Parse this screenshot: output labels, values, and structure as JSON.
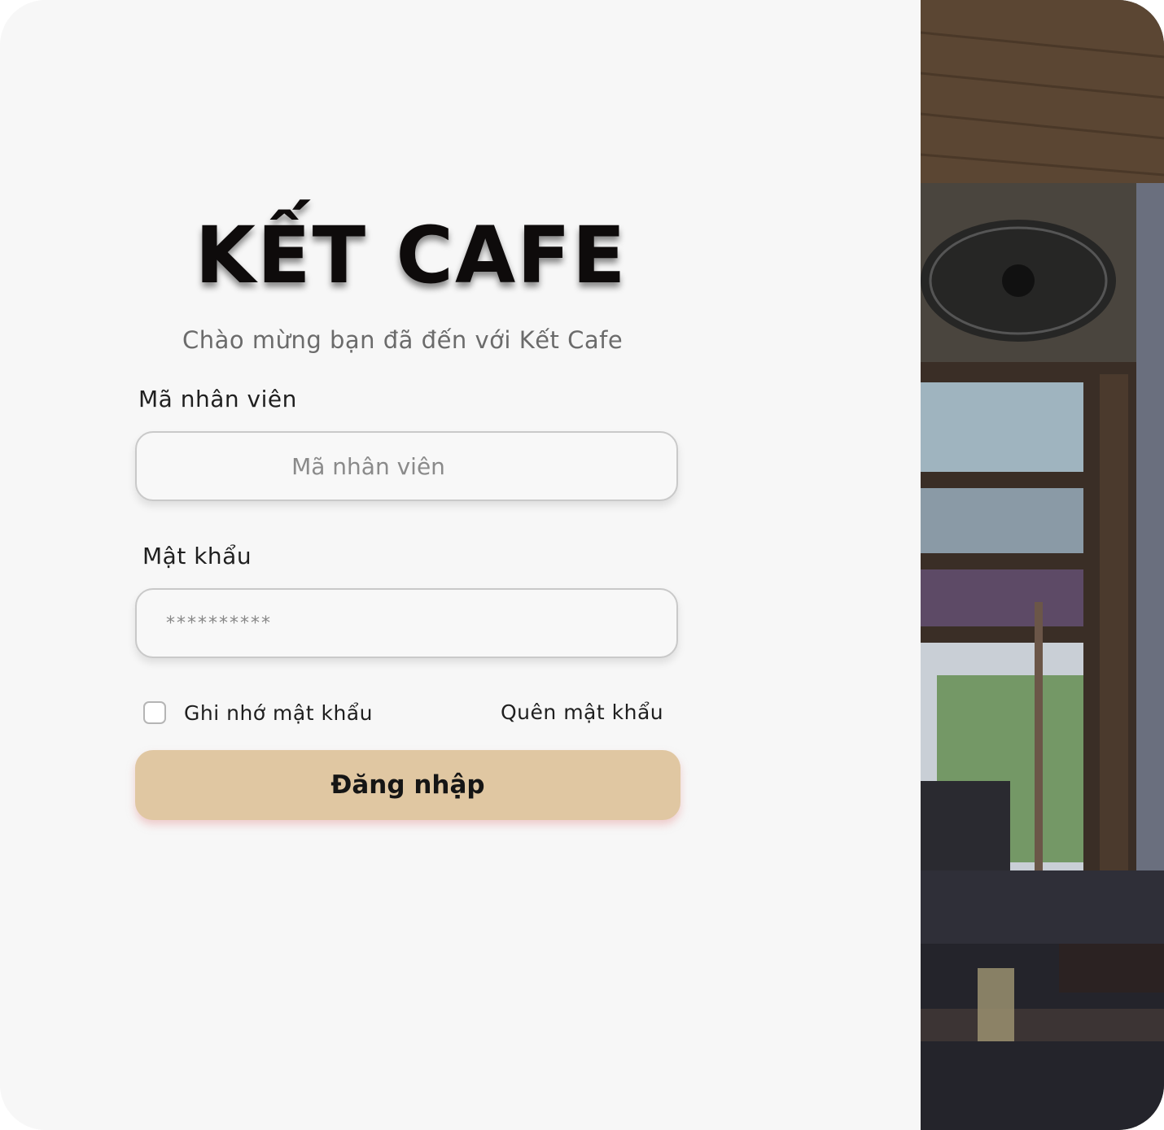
{
  "brand": {
    "title": "KẾT CAFE",
    "subtitle": "Chào mừng bạn đã đến với Kết Cafe"
  },
  "form": {
    "employee_id": {
      "label": "Mã nhân viên",
      "placeholder": "Mã nhân viên",
      "value": ""
    },
    "password": {
      "label": "Mật khẩu",
      "placeholder": "**********",
      "value": ""
    },
    "remember_label": "Ghi nhớ mật khẩu",
    "remember_checked": false,
    "forgot_label": "Quên mật khẩu",
    "submit_label": "Đăng nhập"
  },
  "colors": {
    "background": "#f7f7f7",
    "button": "#e0c7a2",
    "text": "#1f1f1f"
  },
  "hero_image": {
    "icon": "cafe-interior-photo"
  }
}
